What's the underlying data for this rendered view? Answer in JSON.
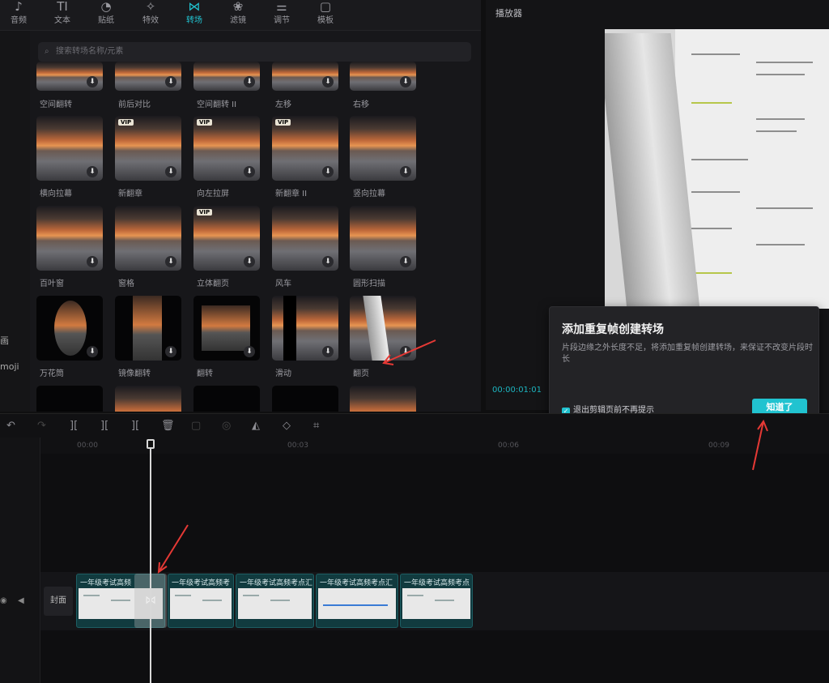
{
  "left_strip": {
    "item1": "画",
    "item2": "moji"
  },
  "toolbar": {
    "tools": [
      {
        "label": "音频",
        "icon": "audio-icon",
        "glyph": "♪"
      },
      {
        "label": "文本",
        "icon": "text-icon",
        "glyph": "TI"
      },
      {
        "label": "贴纸",
        "icon": "sticker-icon",
        "glyph": "◔"
      },
      {
        "label": "特效",
        "icon": "effects-icon",
        "glyph": "✧"
      },
      {
        "label": "转场",
        "icon": "transition-icon",
        "glyph": "⋈"
      },
      {
        "label": "滤镜",
        "icon": "filter-icon",
        "glyph": "❀"
      },
      {
        "label": "调节",
        "icon": "adjust-icon",
        "glyph": "⚌"
      },
      {
        "label": "模板",
        "icon": "template-icon",
        "glyph": "▢"
      }
    ],
    "active": "转场"
  },
  "search": {
    "placeholder": "搜索转场名称/元素"
  },
  "transitions": {
    "row0": [
      "空间翻转",
      "前后对比",
      "空间翻转 II",
      "左移",
      "右移"
    ],
    "row1": [
      "横向拉幕",
      "新翻章",
      "向左拉屏",
      "新翻章 II",
      "竖向拉幕"
    ],
    "row2": [
      "百叶窗",
      "窗格",
      "立体翻页",
      "风车",
      "圆形扫描"
    ],
    "row3": [
      "万花筒",
      "镜像翻转",
      "翻转",
      "滑动",
      "翻页"
    ],
    "vip_label": "VIP"
  },
  "player": {
    "title": "播放器",
    "time": "00:00:01:01"
  },
  "dialog": {
    "title": "添加重复帧创建转场",
    "desc": "片段边缘之外长度不足，将添加重复帧创建转场，来保证不改变片段时长",
    "checkbox_label": "退出剪辑页前不再提示",
    "checkbox_checked": true,
    "ok_label": "知道了"
  },
  "timeline": {
    "ticks": [
      "00:00",
      "00:03",
      "00:06",
      "00:09"
    ],
    "cover_label": "封面",
    "clips": [
      "一年级考试高频",
      "一年级考试高频考",
      "一年级考试高频考点汇",
      "一年级考试高频考点汇",
      "一年级考试高频考点"
    ]
  },
  "colors": {
    "accent": "#21c3d0",
    "annotation_arrow": "#e53935"
  }
}
